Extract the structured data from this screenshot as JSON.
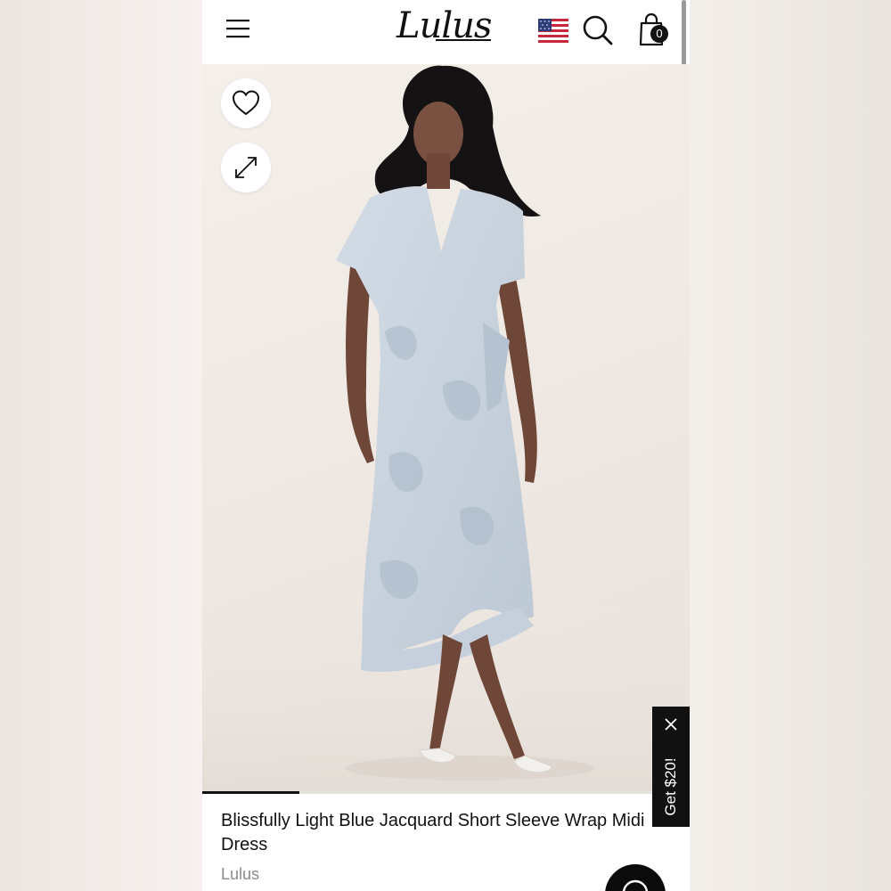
{
  "header": {
    "logo": "Lulus",
    "cart_count": "0"
  },
  "product": {
    "title": "Blissfully Light Blue Jacquard Short Sleeve Wrap Midi Dress",
    "brand": "Lulus",
    "image_progress": 0.2
  },
  "promo": {
    "label": "Get $20!"
  },
  "icons": {
    "menu": "hamburger-menu-icon",
    "flag": "us-flag-icon",
    "search": "search-icon",
    "cart": "shopping-bag-icon",
    "wishlist": "heart-icon",
    "expand": "expand-icon",
    "promo_close": "close-icon",
    "chat": "chat-icon"
  },
  "colors": {
    "accent": "#111111",
    "dress": "#c9d4df",
    "background": "#f1ece8"
  }
}
